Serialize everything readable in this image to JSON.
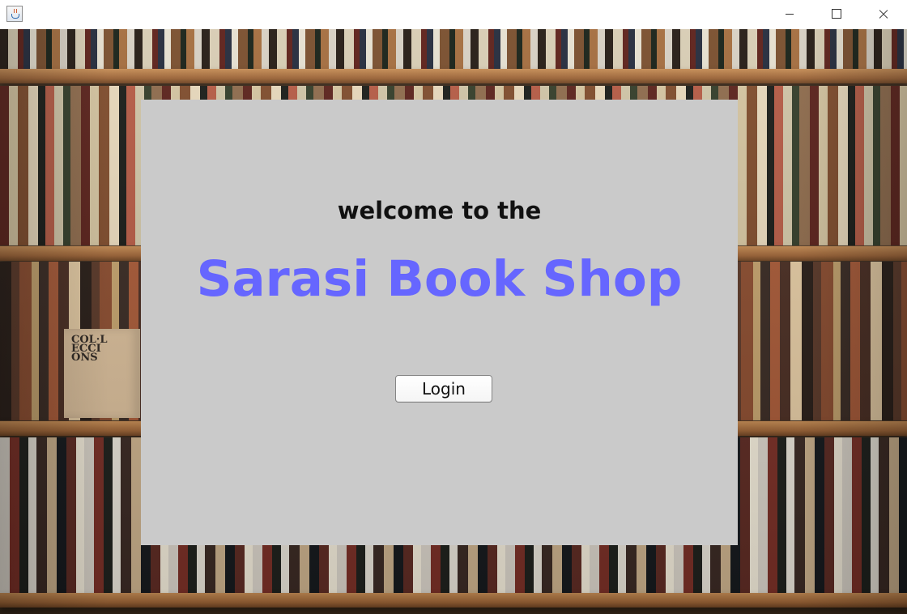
{
  "window": {
    "title": "",
    "controls": {
      "minimize": "",
      "maximize": "",
      "close": ""
    }
  },
  "background": {
    "box_text": "COL·L\nECCI\nONS"
  },
  "welcome": {
    "subtitle": "welcome to the",
    "title": "Sarasi Book Shop",
    "login_button": "Login"
  },
  "colors": {
    "panel_background": "#cacaca",
    "title_color": "#6666ff",
    "subtitle_color": "#111111"
  },
  "icons": {
    "app": "java-app-icon",
    "minimize": "minimize-icon",
    "maximize": "maximize-icon",
    "close": "close-icon"
  }
}
